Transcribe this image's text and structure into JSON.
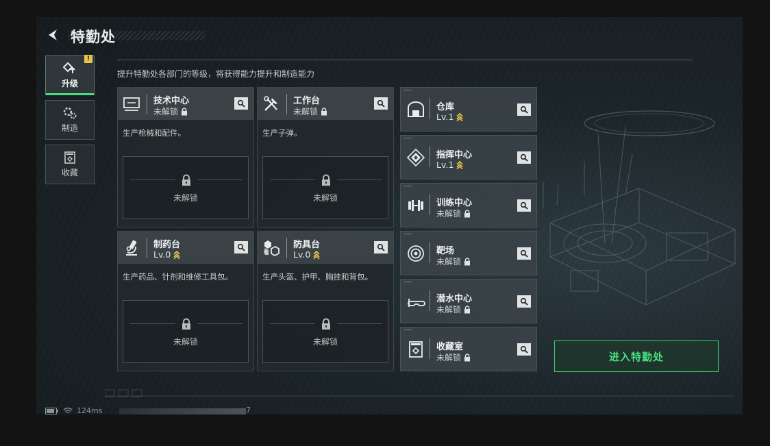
{
  "header": {
    "title": "特勤处"
  },
  "nav": [
    {
      "label": "升级",
      "icon": "upgrade-icon",
      "active": true,
      "badge": "!"
    },
    {
      "label": "制造",
      "icon": "gears-icon",
      "active": false
    },
    {
      "label": "收藏",
      "icon": "collection-icon",
      "active": false
    }
  ],
  "subtitle": "提升特勤处各部门的等级，将获得能力提升和制造能力",
  "big_cards": [
    {
      "name": "技术中心",
      "status": "未解锁",
      "desc": "生产枪械和配件。",
      "locked_text": "未解锁",
      "icon": "computer-icon"
    },
    {
      "name": "工作台",
      "status": "未解锁",
      "desc": "生产子弹。",
      "locked_text": "未解锁",
      "icon": "tools-icon"
    },
    {
      "name": "制药台",
      "status": "Lv.0",
      "desc": "生产药品、针剂和维修工具包。",
      "locked_text": "未解锁",
      "icon": "microscope-icon"
    },
    {
      "name": "防具台",
      "status": "Lv.0",
      "desc": "生产头盔、护甲、胸挂和背包。",
      "locked_text": "未解锁",
      "icon": "armor-icon"
    }
  ],
  "small_cards": [
    {
      "name": "仓库",
      "status": "Lv.1",
      "icon": "warehouse-icon"
    },
    {
      "name": "指挥中心",
      "status": "Lv.1",
      "icon": "command-icon"
    },
    {
      "name": "训练中心",
      "status": "未解锁",
      "icon": "dumbbell-icon"
    },
    {
      "name": "靶场",
      "status": "未解锁",
      "icon": "target-icon"
    },
    {
      "name": "潜水中心",
      "status": "未解锁",
      "icon": "diving-mask-icon"
    },
    {
      "name": "收藏室",
      "status": "未解锁",
      "icon": "collection-room-icon"
    }
  ],
  "enter_button": "进入特勤处",
  "status_bar": {
    "ping": "124ms",
    "counter": "7"
  },
  "colors": {
    "accent_green": "#47e07b",
    "level_gold": "#e8c44a",
    "badge_yellow": "#e8c44a"
  }
}
